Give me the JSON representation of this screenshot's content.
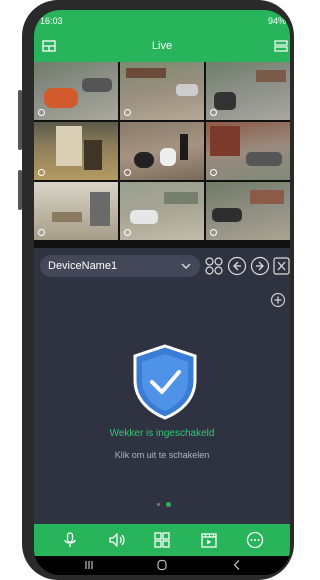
{
  "status_bar": {
    "time": "16:03",
    "battery": "94%"
  },
  "header": {
    "title": "Live"
  },
  "device_selector": {
    "label": "DeviceName1"
  },
  "alarm": {
    "status_text": "Wekker is ingeschakeld",
    "hint_text": "Klik om uit te schakelen"
  },
  "pager": {
    "pages": 2,
    "current": 2
  },
  "colors": {
    "accent": "#27b45a",
    "panel": "#2f3240",
    "active_text": "#2ecc71"
  },
  "icons": {
    "header_left": "layout-icon",
    "header_right": "menu-icon",
    "controls": [
      "grid-select-icon",
      "previous-icon",
      "next-icon",
      "close-icon"
    ],
    "content": "add-device-icon",
    "bottom": [
      "microphone-icon",
      "speaker-icon",
      "layout-grid-icon",
      "playback-icon",
      "more-icon"
    ]
  }
}
